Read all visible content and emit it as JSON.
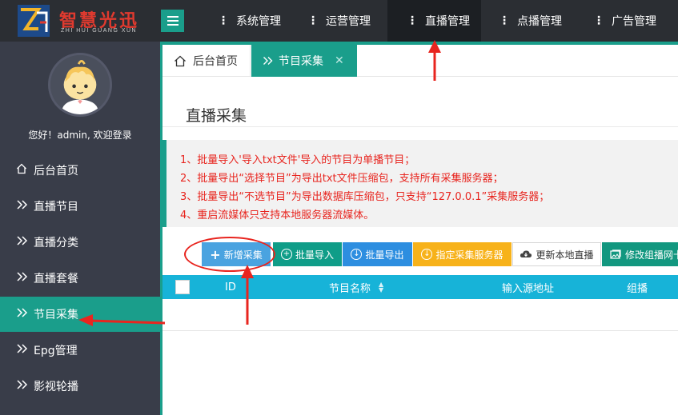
{
  "app": {
    "logo_title": "智慧光迅",
    "logo_subtitle": "ZHI HUI GUANG XUN"
  },
  "topnav": {
    "items": [
      {
        "label": "系统管理",
        "active": false
      },
      {
        "label": "运营管理",
        "active": false
      },
      {
        "label": "直播管理",
        "active": true
      },
      {
        "label": "点播管理",
        "active": false
      },
      {
        "label": "广告管理",
        "active": false
      }
    ]
  },
  "sidebar": {
    "welcome": "您好！admin, 欢迎登录",
    "items": [
      {
        "label": "后台首页",
        "icon": "home-icon",
        "active": false
      },
      {
        "label": "直播节目",
        "icon": "double-chevron-icon",
        "active": false
      },
      {
        "label": "直播分类",
        "icon": "double-chevron-icon",
        "active": false
      },
      {
        "label": "直播套餐",
        "icon": "double-chevron-icon",
        "active": false
      },
      {
        "label": "节目采集",
        "icon": "double-chevron-icon",
        "active": true
      },
      {
        "label": "Epg管理",
        "icon": "double-chevron-icon",
        "active": false
      },
      {
        "label": "影视轮播",
        "icon": "double-chevron-icon",
        "active": false
      }
    ]
  },
  "tabs": {
    "home_label": "后台首页",
    "active_label": "节目采集",
    "close_glyph": "✕"
  },
  "page": {
    "title": "直播采集",
    "notes": [
      "1、批量导入'导入txt文件'导入的节目为单播节目；",
      "2、批量导出“选择节目”为导出txt文件压缩包，支持所有采集服务器；",
      "3、批量导出“不选节目”为导出数据库压缩包，只支持“127.0.0.1”采集服务器；",
      "4、重启流媒体只支持本地服务器流媒体。"
    ]
  },
  "toolbar": {
    "add_label": "新增采集",
    "import_label": "批量导入",
    "export_label": "批量导出",
    "server_label": "指定采集服务器",
    "update_label": "更新本地直播",
    "modify_label": "修改组播网卡"
  },
  "table": {
    "columns": [
      "ID",
      "节目名称",
      "输入源地址",
      "组播"
    ]
  },
  "colors": {
    "accent": "#1a9e8b",
    "topbar": "#2b2e33",
    "sidebar": "#393d49",
    "note_red": "#e8251f",
    "table_header": "#17b3d8",
    "annotation": "#e8251f"
  }
}
